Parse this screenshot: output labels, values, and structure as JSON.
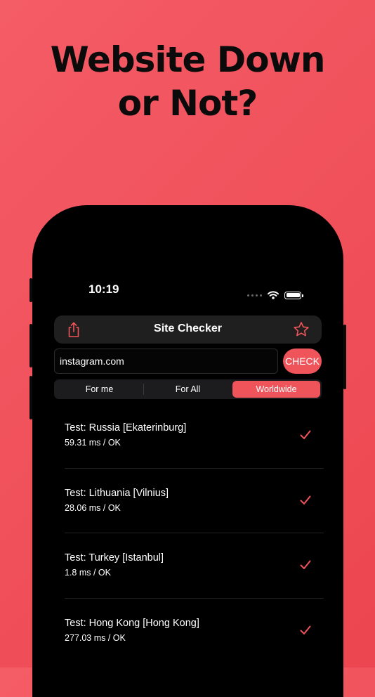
{
  "headline": {
    "line1": "Website Down",
    "line2": "or Not?"
  },
  "colors": {
    "background": "#f0545b",
    "accent": "#f0545b",
    "phone": "#000000",
    "nav_bar": "#1f1f1f"
  },
  "status_bar": {
    "time": "10:19"
  },
  "nav": {
    "title": "Site Checker",
    "left_icon": "share-icon",
    "right_icon": "star-icon"
  },
  "search": {
    "value": "instagram.com",
    "check_label": "CHECK"
  },
  "segments": [
    {
      "label": "For me",
      "active": false
    },
    {
      "label": "For All",
      "active": false
    },
    {
      "label": "Worldwide",
      "active": true
    }
  ],
  "results": [
    {
      "title": "Test: Russia [Ekaterinburg]",
      "subtitle": "59.31 ms / OK",
      "status_icon": "checkmark-icon"
    },
    {
      "title": "Test: Lithuania [Vilnius]",
      "subtitle": "28.06 ms / OK",
      "status_icon": "checkmark-icon"
    },
    {
      "title": "Test: Turkey [Istanbul]",
      "subtitle": "1.8 ms / OK",
      "status_icon": "checkmark-icon"
    },
    {
      "title": "Test: Hong Kong [Hong Kong]",
      "subtitle": "277.03 ms / OK",
      "status_icon": "checkmark-icon"
    }
  ]
}
